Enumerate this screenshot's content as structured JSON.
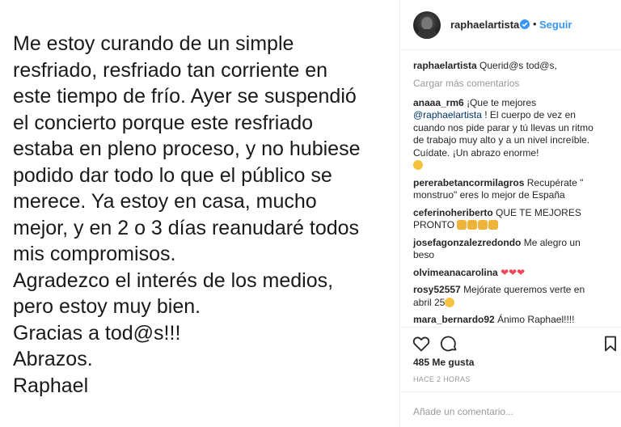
{
  "post": {
    "lines": [
      "Me estoy curando de un simple",
      "resfriado, resfriado tan corriente en",
      "este tiempo de frío. Ayer se suspendió",
      "el concierto porque este resfriado",
      "estaba en pleno proceso, y no hubiese",
      "podido dar todo lo que el público se",
      "merece. Ya estoy en casa, mucho",
      "mejor, y en 2 o 3 días reanudaré todos",
      "mis compromisos.",
      "Agradezco el interés de los medios,",
      "pero estoy muy bien.",
      "Gracias a tod@s!!!",
      "Abrazos.",
      "Raphael"
    ]
  },
  "header": {
    "username": "raphaelartista",
    "separator": "•",
    "follow_label": "Seguir",
    "avatar_icon": "profile-avatar",
    "verified_icon": "verified-badge-icon",
    "verified_color": "#3897f0"
  },
  "caption": {
    "user": "raphaelartista",
    "text": "Querid@s tod@s,"
  },
  "load_more_label": "Cargar más comentarios",
  "comments": [
    {
      "user": "anaaa_rm6",
      "text_pre": "¡Que te mejores ",
      "mention": "@raphaelartista",
      "text_post": " ! El cuerpo de vez en cuando nos pide parar y tú llevas un ritmo de trabajo muy alto y a un nivel increíble. Cuídate. ¡Un abrazo enorme!",
      "emoji": "smile"
    },
    {
      "user": "pererabetancormilagros",
      "text": "Recupérate \" monstruo\" eres lo mejor de España"
    },
    {
      "user": "ceferinoheriberto",
      "text": "QUE TE MEJORES PRONTO",
      "emoji": "pray x4"
    },
    {
      "user": "josefagonzalezredondo",
      "text": "Me alegro un beso"
    },
    {
      "user": "olvimeanacarolina",
      "hearts": "❤❤❤"
    },
    {
      "user": "rosy52557",
      "text": "Mejórate queremos verte en abril 25",
      "emoji": "grin"
    },
    {
      "user": "mara_bernardo92",
      "text": "Ánimo Raphael!!!!"
    }
  ],
  "actions": {
    "like_icon": "heart-outline-icon",
    "comment_icon": "comment-bubble-icon",
    "save_icon": "bookmark-icon"
  },
  "likes_label": "485 Me gusta",
  "time_label": "HACE 2 HORAS",
  "add_comment_placeholder": "Añade un comentario..."
}
